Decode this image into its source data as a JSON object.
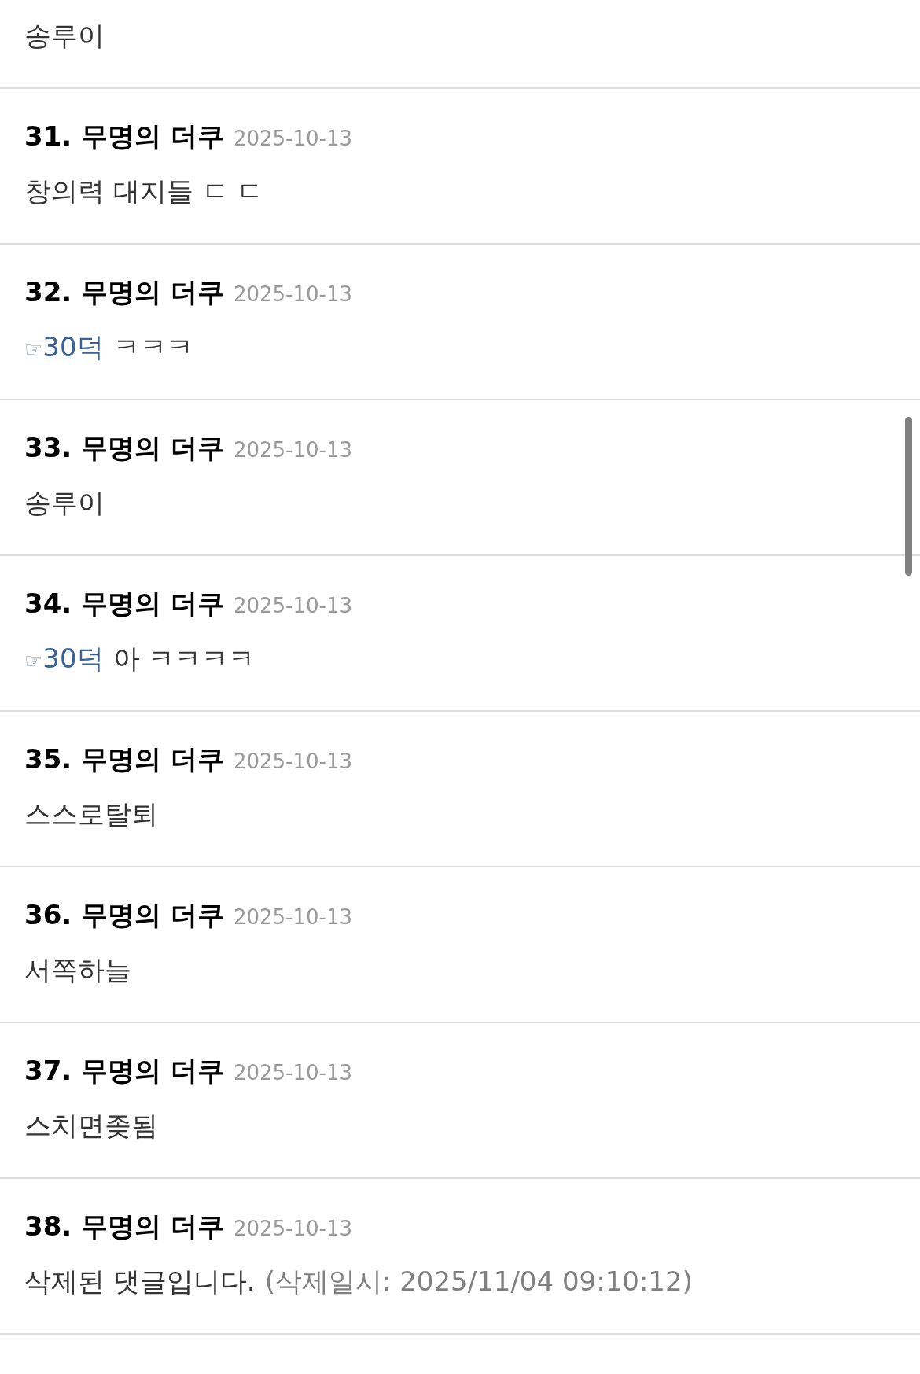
{
  "comments": [
    {
      "body": [
        {
          "kind": "text",
          "text": "송루이"
        }
      ]
    },
    {
      "title": "31. 무명의 더쿠",
      "date": "2025-10-13",
      "body": [
        {
          "kind": "text",
          "text": "창의력 대지들 ㄷ ㄷ"
        }
      ]
    },
    {
      "title": "32. 무명의 더쿠",
      "date": "2025-10-13",
      "body": [
        {
          "kind": "reply",
          "icon": "☞",
          "text": "30덕"
        },
        {
          "kind": "text",
          "text": "ㅋㅋㅋ"
        }
      ]
    },
    {
      "title": "33. 무명의 더쿠",
      "date": "2025-10-13",
      "body": [
        {
          "kind": "text",
          "text": "송루이"
        }
      ]
    },
    {
      "title": "34. 무명의 더쿠",
      "date": "2025-10-13",
      "body": [
        {
          "kind": "reply",
          "icon": "☞",
          "text": "30덕"
        },
        {
          "kind": "text",
          "text": "아 ㅋㅋㅋㅋ"
        }
      ]
    },
    {
      "title": "35. 무명의 더쿠",
      "date": "2025-10-13",
      "body": [
        {
          "kind": "text",
          "text": "스스로탈퇴"
        }
      ]
    },
    {
      "title": "36. 무명의 더쿠",
      "date": "2025-10-13",
      "body": [
        {
          "kind": "text",
          "text": "서쪽하늘"
        }
      ]
    },
    {
      "title": "37. 무명의 더쿠",
      "date": "2025-10-13",
      "body": [
        {
          "kind": "text",
          "text": "스치면좆됨"
        }
      ]
    },
    {
      "title": "38. 무명의 더쿠",
      "date": "2025-10-13",
      "body": [
        {
          "kind": "text",
          "text": "삭제된 댓글입니다."
        },
        {
          "kind": "note",
          "text": "(삭제일시: 2025/11/04 09:10:12)"
        }
      ]
    }
  ]
}
